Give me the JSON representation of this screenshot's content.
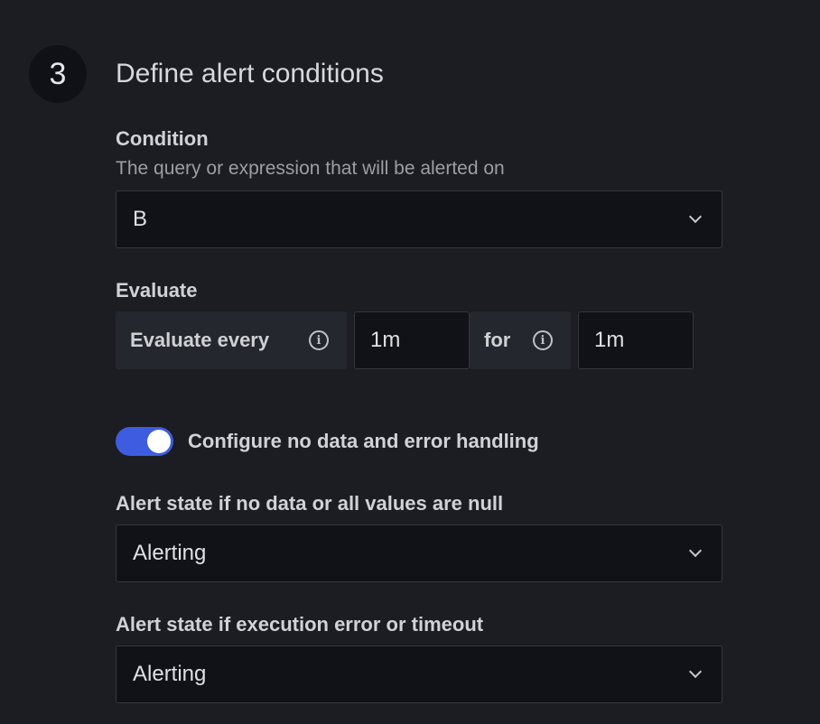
{
  "section": {
    "step_number": "3",
    "title": "Define alert conditions"
  },
  "condition": {
    "label": "Condition",
    "description": "The query or expression that will be alerted on",
    "selected": "B"
  },
  "evaluate": {
    "label": "Evaluate",
    "every_label": "Evaluate every",
    "every_value": "1m",
    "for_label": "for",
    "for_value": "1m"
  },
  "no_data_toggle": {
    "label": "Configure no data and error handling",
    "enabled": true,
    "color": "#3d5ce0"
  },
  "no_data_state": {
    "label": "Alert state if no data or all values are null",
    "selected": "Alerting"
  },
  "error_state": {
    "label": "Alert state if execution error or timeout",
    "selected": "Alerting"
  },
  "icons": {
    "info": "info-circle-icon",
    "chevron": "chevron-down-icon"
  }
}
